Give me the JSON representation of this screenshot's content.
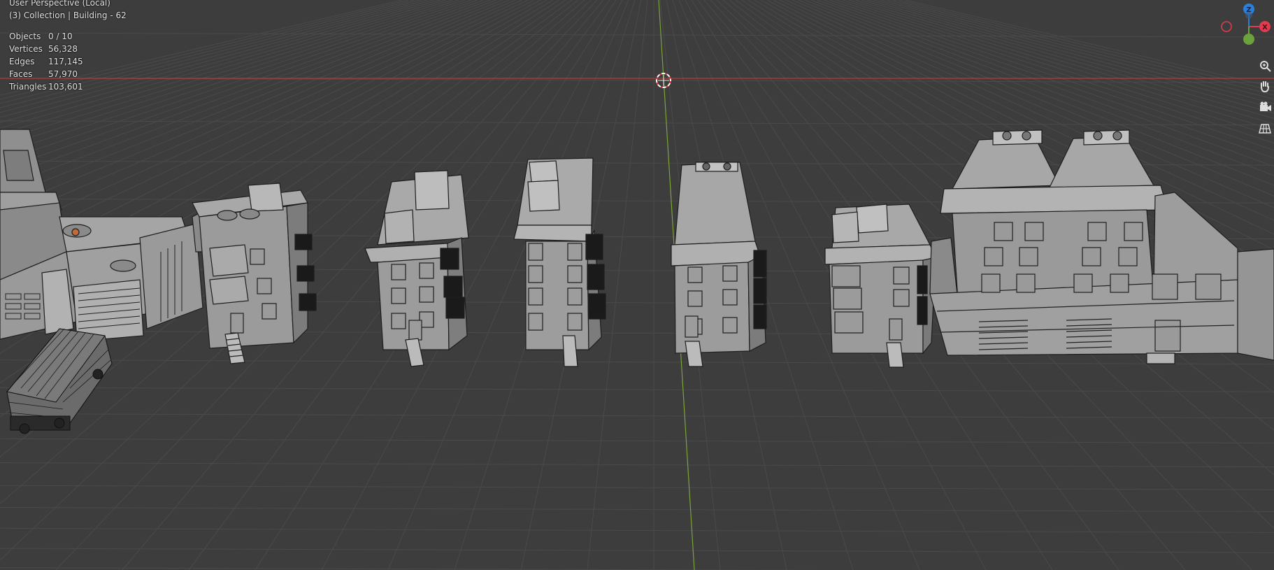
{
  "viewport": {
    "view_name": "User Perspective (Local)",
    "context": "(3) Collection | Building - 62"
  },
  "stats": [
    {
      "label": "Objects",
      "value": "0 / 10"
    },
    {
      "label": "Vertices",
      "value": "56,328"
    },
    {
      "label": "Edges",
      "value": "117,145"
    },
    {
      "label": "Faces",
      "value": "57,970"
    },
    {
      "label": "Triangles",
      "value": "103,601"
    }
  ],
  "gizmo": {
    "z_label": "Z",
    "x_label": "X",
    "z_color": "#2b7fdb",
    "x_color": "#e03c50",
    "y_color": "#6ba33a"
  },
  "nav_tools": [
    "zoom-icon",
    "hand-pan-icon",
    "camera-icon",
    "grid-perspective-icon"
  ],
  "colors": {
    "background": "#3d3d3d",
    "grid_line": "#4a4a4a",
    "x_axis": "#b83a3a",
    "y_axis": "#7aa33c",
    "building_fill": "#9d9d9d",
    "building_shadow": "#7d7d7d",
    "wire": "#1e1e1e"
  }
}
